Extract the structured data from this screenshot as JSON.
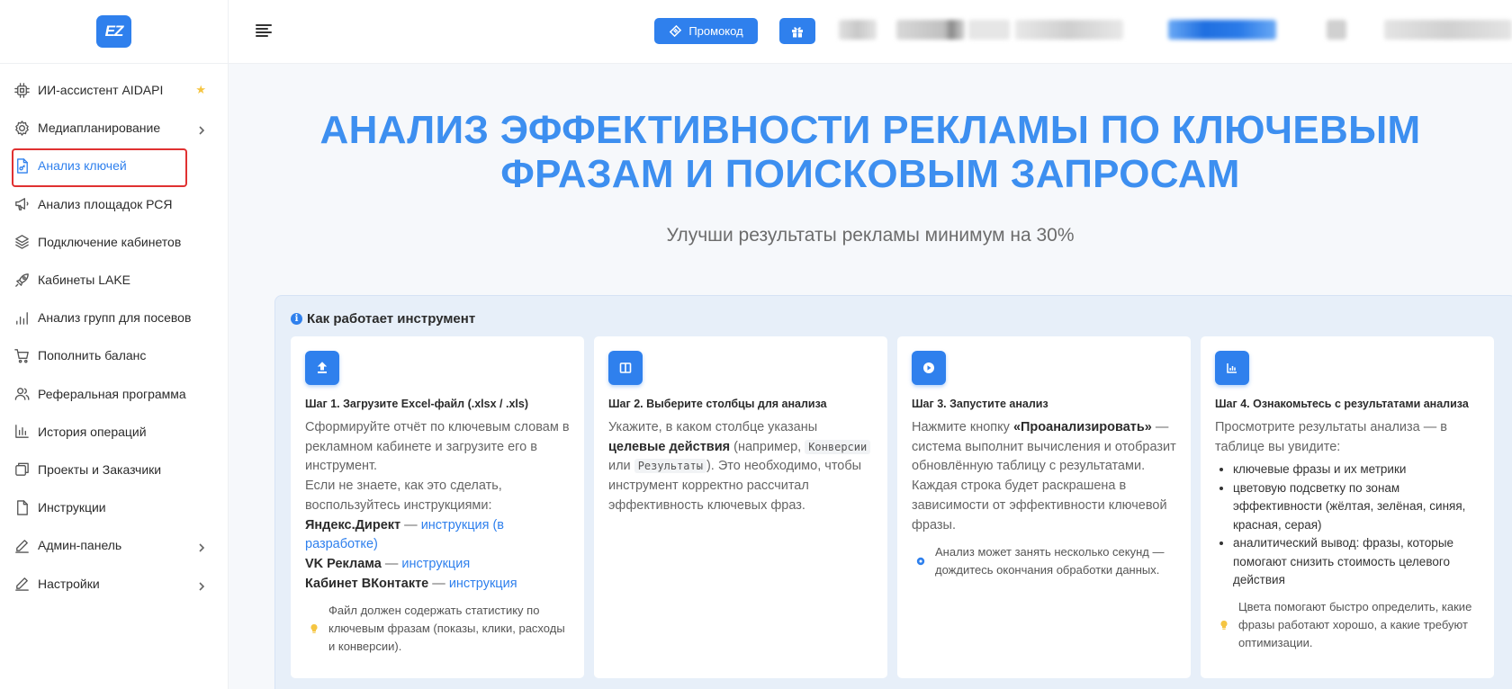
{
  "app": {
    "logo_text": "EZ",
    "accent_color": "#2f80ed"
  },
  "sidebar": {
    "items": [
      {
        "label": "ИИ-ассистент AIDAPI",
        "icon": "chip-icon",
        "star": "★"
      },
      {
        "label": "Медиапланирование",
        "icon": "gear-icon",
        "has_submenu": true
      },
      {
        "label": "Анализ ключей",
        "icon": "document-key-icon",
        "active": true
      },
      {
        "label": "Анализ площадок РСЯ",
        "icon": "megaphone-icon"
      },
      {
        "label": "Подключение кабинетов",
        "icon": "layers-icon"
      },
      {
        "label": "Кабинеты LAKE",
        "icon": "rocket-icon"
      },
      {
        "label": "Анализ групп для посевов",
        "icon": "bars-icon"
      },
      {
        "label": "Пополнить баланс",
        "icon": "cart-icon"
      },
      {
        "label": "Реферальная программа",
        "icon": "users-icon"
      },
      {
        "label": "История операций",
        "icon": "chart-icon"
      },
      {
        "label": "Проекты и Заказчики",
        "icon": "boxes-icon"
      },
      {
        "label": "Инструкции",
        "icon": "file-icon"
      },
      {
        "label": "Админ-панель",
        "icon": "pen-icon",
        "has_submenu": true
      },
      {
        "label": "Настройки",
        "icon": "pen-icon",
        "has_submenu": true
      }
    ]
  },
  "topbar": {
    "promo_label": "Промокод",
    "gift_icon": "gift-icon"
  },
  "hero": {
    "title_line1": "АНАЛИЗ ЭФФЕКТИВНОСТИ РЕКЛАМЫ ПО КЛЮЧЕВЫМ",
    "title_line2": "ФРАЗАМ И ПОИСКОВЫМ ЗАПРОСАМ",
    "subtitle": "Улучши результаты рекламы минимум на 30%"
  },
  "how": {
    "title": "Как работает инструмент",
    "steps": [
      {
        "icon": "upload-icon",
        "title": "Шаг 1. Загрузите Excel-файл (.xlsx / .xls)",
        "text_1": "Сформируйте отчёт по ключевым словам в рекламном кабинете и загрузите его в инструмент.",
        "text_2": "Если не знаете, как это сделать, воспользуйтесь инструкциями:",
        "yandex_label": "Яндекс.Директ",
        "yandex_link": "инструкция (в разработке)",
        "vk_label": "VK Реклама",
        "vk_link": "инструкция",
        "vkontakte_label": "Кабинет ВКонтакте",
        "vkontakte_link": "инструкция",
        "dash": " — ",
        "note": "Файл должен содержать статистику по ключевым фразам (показы, клики, расходы и конверсии)."
      },
      {
        "icon": "columns-icon",
        "title": "Шаг 2. Выберите столбцы для анализа",
        "text_a": "Укажите, в каком столбце указаны",
        "text_b": "целевые действия",
        "text_c": "(например,",
        "code_1": "Конверсии",
        "text_d": "или",
        "code_2": "Результаты",
        "text_e": "). Это необходимо, чтобы инструмент корректно рассчитал эффективность ключевых фраз."
      },
      {
        "icon": "play-icon",
        "title": "Шаг 3. Запустите анализ",
        "text_a": "Нажмите кнопку",
        "text_b": "«Проанализировать»",
        "text_c": "— система выполнит вычисления и отобразит обновлённую таблицу с результатами. Каждая строка будет раскрашена в зависимости от эффективности ключевой фразы.",
        "note": "Анализ может занять несколько секунд — дождитесь окончания обработки данных."
      },
      {
        "icon": "bar-chart-icon",
        "title": "Шаг 4. Ознакомьтесь с результатами анализа",
        "text": "Просмотрите результаты анализа — в таблице вы увидите:",
        "bullets": [
          "ключевые фразы и их метрики",
          "цветовую подсветку по зонам эффективности (жёлтая, зелёная, синяя, красная, серая)",
          "аналитический вывод: фразы, которые помогают снизить стоимость целевого действия"
        ],
        "note": "Цвета помогают быстро определить, какие фразы работают хорошо, а какие требуют оптимизации."
      }
    ]
  }
}
